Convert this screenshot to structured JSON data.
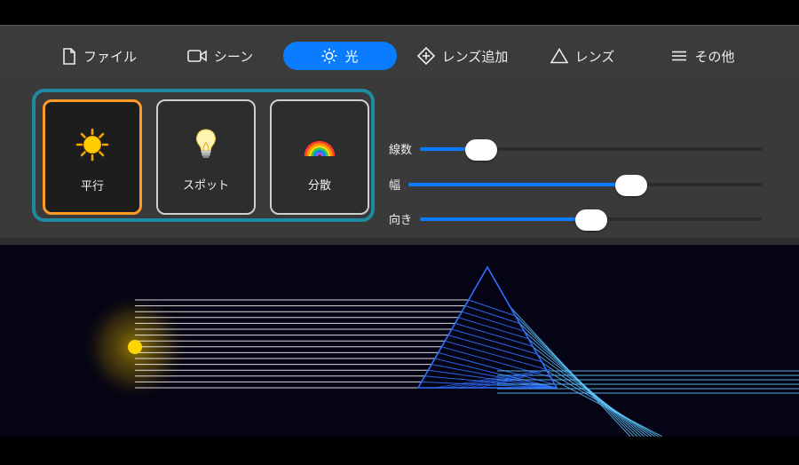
{
  "tabs": [
    {
      "label": "ファイル",
      "icon": "document-icon",
      "active": false
    },
    {
      "label": "シーン",
      "icon": "video-camera-icon",
      "active": false
    },
    {
      "label": "光",
      "icon": "sun-outline-icon",
      "active": true
    },
    {
      "label": "レンズ追加",
      "icon": "diamond-plus-icon",
      "active": false
    },
    {
      "label": "レンズ",
      "icon": "triangle-icon",
      "active": false
    },
    {
      "label": "その他",
      "icon": "hamburger-menu-icon",
      "active": false
    }
  ],
  "light_types": [
    {
      "label": "平行",
      "icon": "sun-icon",
      "selected": true
    },
    {
      "label": "スポット",
      "icon": "lightbulb-icon",
      "selected": false
    },
    {
      "label": "分散",
      "icon": "rainbow-icon",
      "selected": false
    }
  ],
  "sliders": [
    {
      "label": "線数",
      "value": 0.18
    },
    {
      "label": "幅",
      "value": 0.63
    },
    {
      "label": "向き",
      "value": 0.5
    }
  ],
  "colors": {
    "accent": "#0a7cff",
    "selected_border": "#ff9a26",
    "group_border": "#1f8aa0",
    "ray": "#ffffff",
    "prism": "#2f6fff",
    "refracted": "#5ec8ff",
    "source": "#ffd400"
  }
}
